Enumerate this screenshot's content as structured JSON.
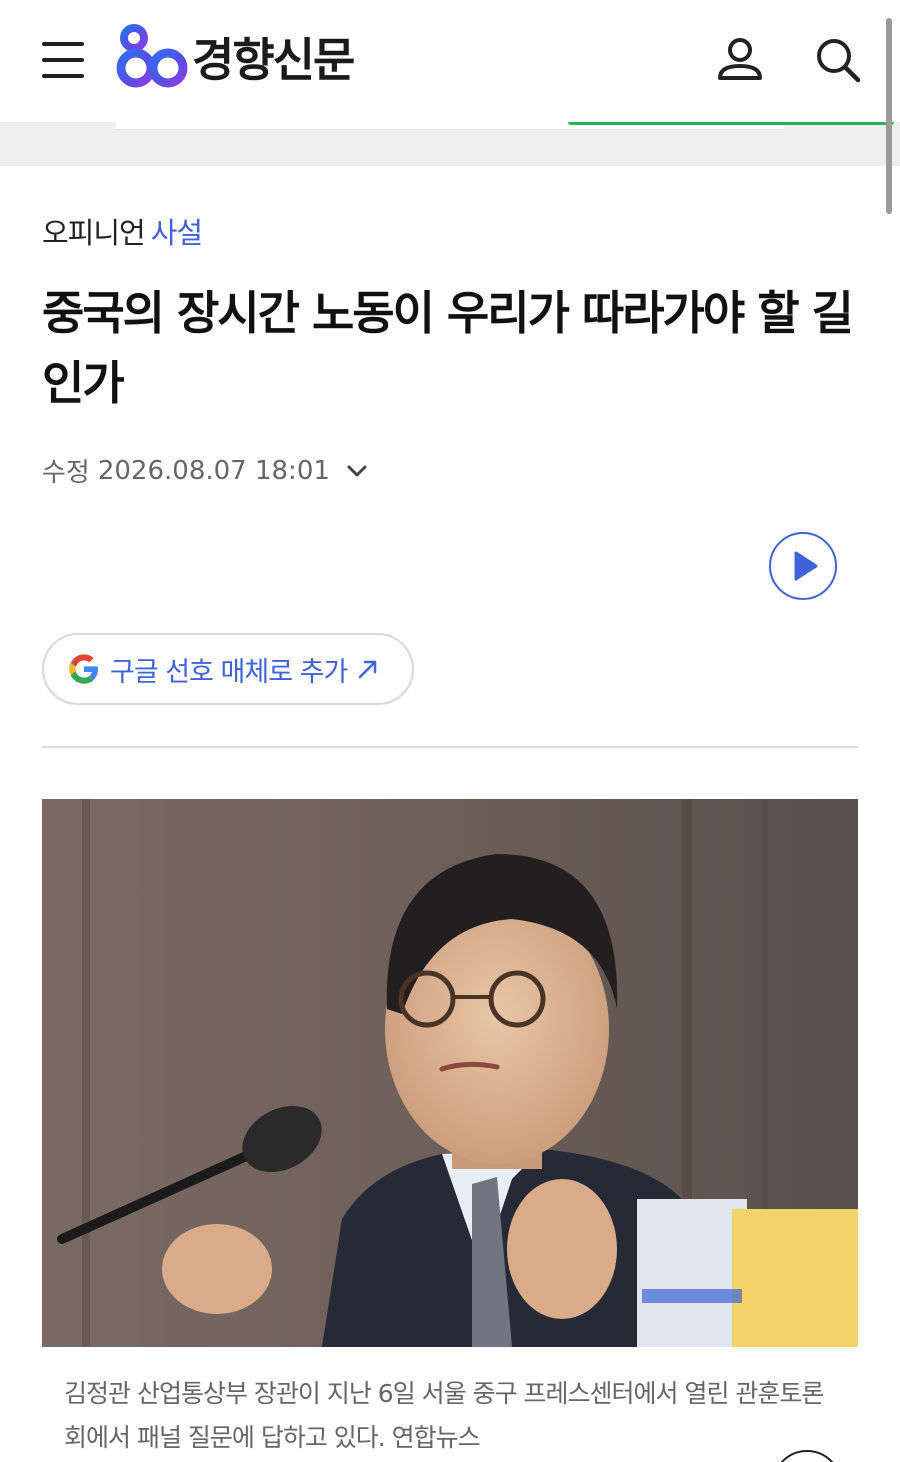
{
  "header": {
    "logo_text": "경향신문",
    "menu_icon": "hamburger-menu-icon",
    "user_icon": "user-icon",
    "search_icon": "search-icon"
  },
  "article": {
    "section": "오피니언",
    "subsection": "사설",
    "title": "중국의 장시간 노동이 우리가 따라가야 할 길인가",
    "modified_label": "수정",
    "modified_time": "2026.08.07 18:01",
    "google_button_label": "구글 선호 매체로 추가",
    "photo_caption": "김정관 산업통상부 장관이 지난 6일 서울 중구 프레스센터에서 열린 관훈토론회에서 패널 질문에 답하고 있다. 연합뉴스"
  },
  "colors": {
    "accent": "#3f63d6",
    "green_line": "#1fb35c",
    "text_muted": "#666666"
  }
}
